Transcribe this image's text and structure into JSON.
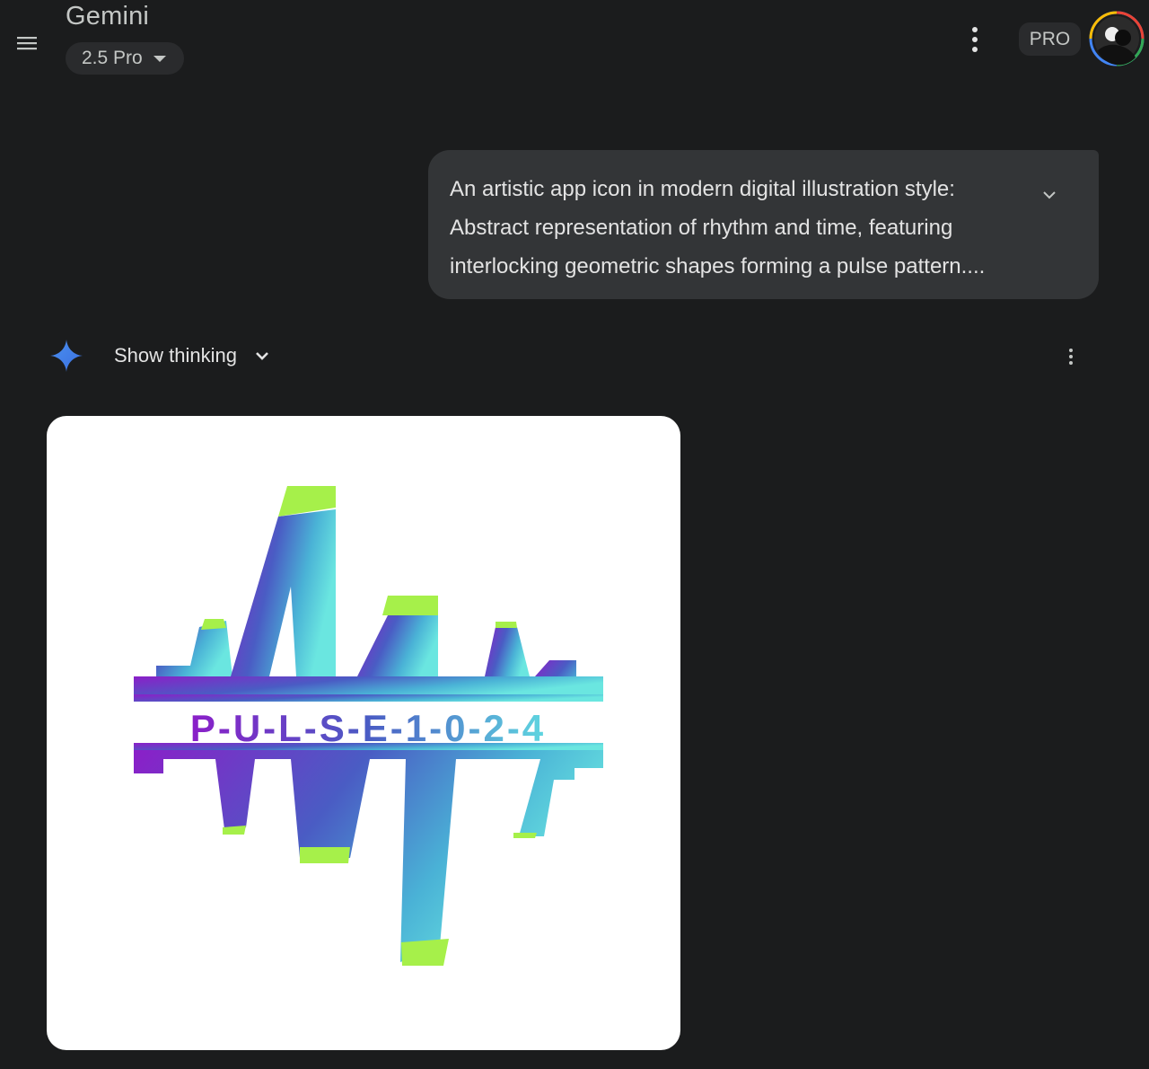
{
  "header": {
    "app_title": "Gemini",
    "model_label": "2.5 Pro",
    "pro_badge": "PRO",
    "icons": [
      "menu-icon",
      "chevron-down-icon",
      "more-vert-icon",
      "avatar"
    ]
  },
  "prompt": {
    "lines": [
      "An artistic app icon in modern digital illustration style:",
      "Abstract representation of rhythm and time, featuring",
      "interlocking geometric shapes forming a pulse pattern...."
    ],
    "icon": "chevron-down-icon"
  },
  "response": {
    "show_thinking_label": "Show thinking",
    "icons": [
      "gemini-spark-icon",
      "chevron-down-icon",
      "more-vert-icon"
    ],
    "image": {
      "wordmark": "P-U-L-S-E-1-0-2-4"
    }
  },
  "colors": {
    "background": "#1b1c1d",
    "bubble": "#333537",
    "spark_blue": "#4285f4",
    "purple": "#8b1fc8",
    "cyan": "#5fe0e0",
    "lime": "#a6f04a"
  }
}
